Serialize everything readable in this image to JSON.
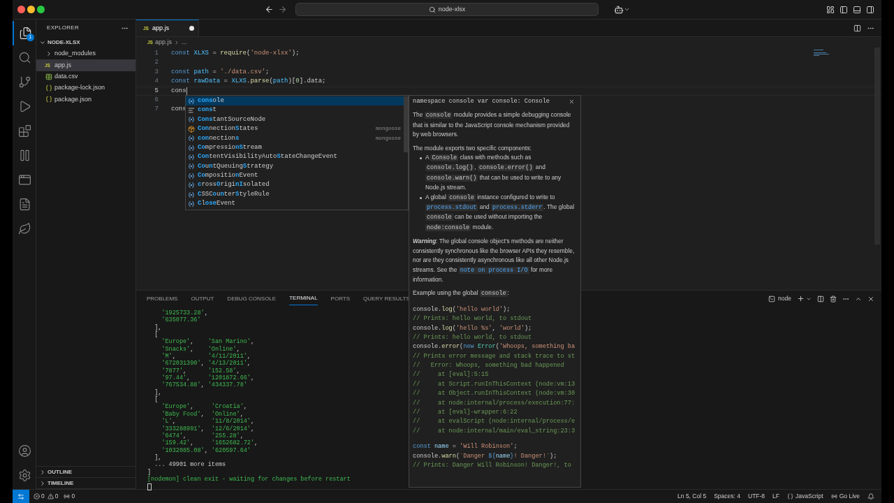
{
  "window": {
    "search": "node-xlsx"
  },
  "activity_bar": {
    "items": [
      {
        "kind": "files",
        "selected": true,
        "badge": "1"
      },
      {
        "kind": "search",
        "selected": false
      },
      {
        "kind": "source-control",
        "selected": false
      },
      {
        "kind": "run",
        "selected": false
      },
      {
        "kind": "extensions",
        "selected": false
      },
      {
        "kind": "bars",
        "selected": false
      },
      {
        "kind": "window",
        "selected": false
      },
      {
        "kind": "page",
        "selected": false
      },
      {
        "kind": "leaf",
        "selected": false
      }
    ],
    "bottom": [
      {
        "kind": "account"
      },
      {
        "kind": "settings"
      }
    ]
  },
  "sidebar": {
    "title": "EXPLORER",
    "section": {
      "label": "NODE-XLSX",
      "expanded": true,
      "children": [
        {
          "label": "node_modules",
          "kind": "folder",
          "expanded": false,
          "selected": false
        },
        {
          "label": "app.js",
          "kind": "js",
          "icon_text": "JS",
          "selected": true
        },
        {
          "label": "data.csv",
          "kind": "csv",
          "selected": false
        },
        {
          "label": "package-lock.json",
          "kind": "json",
          "selected": false
        },
        {
          "label": "package.json",
          "kind": "json",
          "selected": false
        }
      ]
    },
    "bottom_sections": [
      {
        "label": "OUTLINE",
        "expanded": false
      },
      {
        "label": "TIMELINE",
        "expanded": false
      }
    ]
  },
  "editor": {
    "tabs": [
      {
        "label": "app.js",
        "icon_text": "JS",
        "selected": true,
        "modified": true
      }
    ],
    "breadcrumb": {
      "icon_text": "JS",
      "file": "app.js",
      "rest": "..."
    },
    "lines": [
      {
        "number": "1",
        "current": false,
        "tokens": [
          {
            "text": "const ",
            "kind": "kw"
          },
          {
            "text": "XLXS",
            "kind": "const"
          },
          {
            "text": " = ",
            "kind": "p"
          },
          {
            "text": "require",
            "kind": "fn"
          },
          {
            "text": "(",
            "kind": "p"
          },
          {
            "text": "'node-xlsx'",
            "kind": "str"
          },
          {
            "text": ");",
            "kind": "p"
          }
        ]
      },
      {
        "number": "2",
        "current": false
      },
      {
        "number": "3",
        "current": false,
        "tokens": [
          {
            "text": "const ",
            "kind": "kw"
          },
          {
            "text": "path",
            "kind": "const"
          },
          {
            "text": " = ",
            "kind": "p"
          },
          {
            "text": "'./data.csv'",
            "kind": "str"
          },
          {
            "text": ";",
            "kind": "p"
          }
        ]
      },
      {
        "number": "4",
        "current": false,
        "tokens": [
          {
            "text": "const ",
            "kind": "kw"
          },
          {
            "text": "rawData",
            "kind": "const"
          },
          {
            "text": " = ",
            "kind": "p"
          },
          {
            "text": "XLXS",
            "kind": "const"
          },
          {
            "text": ".",
            "kind": "p"
          },
          {
            "text": "parse",
            "kind": "fn"
          },
          {
            "text": "(",
            "kind": "p"
          },
          {
            "text": "path",
            "kind": "const"
          },
          {
            "text": ")[",
            "kind": "p"
          },
          {
            "text": "0",
            "kind": "num"
          },
          {
            "text": "].data;",
            "kind": "p"
          }
        ]
      },
      {
        "number": "5",
        "current": true,
        "tokens": [
          {
            "text": "cons",
            "kind": "p"
          }
        ]
      },
      {
        "number": "6",
        "current": false
      },
      {
        "number": "7",
        "current": false,
        "tokens": [
          {
            "text": "cons",
            "kind": "p"
          }
        ]
      }
    ]
  },
  "suggestions": [
    {
      "kind": "variable",
      "selected": true,
      "segments": [
        {
          "text": "cons",
          "kind": "match"
        },
        {
          "text": "ole",
          "kind": "rest"
        }
      ]
    },
    {
      "kind": "snippet",
      "selected": false,
      "segments": [
        {
          "text": "cons",
          "kind": "match"
        },
        {
          "text": "t",
          "kind": "rest"
        }
      ]
    },
    {
      "kind": "variable",
      "selected": false,
      "segments": [
        {
          "text": "Cons",
          "kind": "match"
        },
        {
          "text": "tantSourceNode",
          "kind": "rest"
        }
      ]
    },
    {
      "kind": "module",
      "selected": false,
      "detail": "mongoose",
      "segments": [
        {
          "text": "Con",
          "kind": "match"
        },
        {
          "text": "nection",
          "kind": "rest"
        },
        {
          "text": "S",
          "kind": "match"
        },
        {
          "text": "tates",
          "kind": "rest"
        }
      ]
    },
    {
      "kind": "variable",
      "selected": false,
      "detail": "mongoose",
      "segments": [
        {
          "text": "con",
          "kind": "match"
        },
        {
          "text": "nection",
          "kind": "rest"
        },
        {
          "text": "s",
          "kind": "match"
        }
      ]
    },
    {
      "kind": "variable",
      "selected": false,
      "segments": [
        {
          "text": "Co",
          "kind": "match"
        },
        {
          "text": "mpressio",
          "kind": "rest"
        },
        {
          "text": "nS",
          "kind": "match"
        },
        {
          "text": "tream",
          "kind": "rest"
        }
      ]
    },
    {
      "kind": "variable",
      "selected": false,
      "segments": [
        {
          "text": "Con",
          "kind": "match"
        },
        {
          "text": "tentVisibilityAuto",
          "kind": "rest"
        },
        {
          "text": "S",
          "kind": "match"
        },
        {
          "text": "tateChangeEvent",
          "kind": "rest"
        }
      ]
    },
    {
      "kind": "variable",
      "selected": false,
      "segments": [
        {
          "text": "Co",
          "kind": "match"
        },
        {
          "text": "u",
          "kind": "rest"
        },
        {
          "text": "n",
          "kind": "match"
        },
        {
          "text": "tQueuing",
          "kind": "rest"
        },
        {
          "text": "S",
          "kind": "match"
        },
        {
          "text": "trategy",
          "kind": "rest"
        }
      ]
    },
    {
      "kind": "variable",
      "selected": false,
      "segments": [
        {
          "text": "Co",
          "kind": "match"
        },
        {
          "text": "mpositio",
          "kind": "rest"
        },
        {
          "text": "n",
          "kind": "match"
        },
        {
          "text": "Event",
          "kind": "rest"
        }
      ]
    },
    {
      "kind": "variable",
      "selected": false,
      "segments": [
        {
          "text": "c",
          "kind": "match"
        },
        {
          "text": "ross",
          "kind": "rest"
        },
        {
          "text": "O",
          "kind": "match"
        },
        {
          "text": "rigi",
          "kind": "rest"
        },
        {
          "text": "nI",
          "kind": "match"
        },
        {
          "text": "solated",
          "kind": "rest"
        }
      ]
    },
    {
      "kind": "variable",
      "selected": false,
      "segments": [
        {
          "text": "C",
          "kind": "match"
        },
        {
          "text": "SSC",
          "kind": "rest"
        },
        {
          "text": "o",
          "kind": "match"
        },
        {
          "text": "u",
          "kind": "rest"
        },
        {
          "text": "n",
          "kind": "match"
        },
        {
          "text": "ter",
          "kind": "rest"
        },
        {
          "text": "S",
          "kind": "match"
        },
        {
          "text": "tyleRule",
          "kind": "rest"
        }
      ]
    },
    {
      "kind": "variable",
      "selected": false,
      "segments": [
        {
          "text": "C",
          "kind": "match"
        },
        {
          "text": "l",
          "kind": "rest"
        },
        {
          "text": "ose",
          "kind": "match"
        },
        {
          "text": "Event",
          "kind": "rest"
        }
      ]
    }
  ],
  "docs": {
    "signature": "namespace console var console: Console",
    "blocks": [
      {
        "kind": "paragraph",
        "parts": [
          {
            "text": "The ",
            "kind": "text"
          },
          {
            "text": "console",
            "kind": "code"
          },
          {
            "text": " module provides a simple debugging console that is similar to the JavaScript console mechanism provided by web browsers.",
            "kind": "text"
          }
        ]
      },
      {
        "kind": "paragraph",
        "parts": [
          {
            "text": "The module exports two specific components:",
            "kind": "text"
          }
        ]
      },
      {
        "kind": "bullet",
        "parts": [
          {
            "text": "A ",
            "kind": "text"
          },
          {
            "text": "Console",
            "kind": "code"
          },
          {
            "text": " class with methods such as ",
            "kind": "text"
          },
          {
            "text": "console.log()",
            "kind": "code"
          },
          {
            "text": ", ",
            "kind": "text"
          },
          {
            "text": "console.error()",
            "kind": "code"
          },
          {
            "text": " and ",
            "kind": "text"
          },
          {
            "text": "console.warn()",
            "kind": "code"
          },
          {
            "text": " that can be used to write to any Node.js stream.",
            "kind": "text"
          }
        ]
      },
      {
        "kind": "bullet",
        "parts": [
          {
            "text": "A global ",
            "kind": "text"
          },
          {
            "text": "console",
            "kind": "code"
          },
          {
            "text": " instance configured to write to ",
            "kind": "text"
          },
          {
            "text": "process.stdout",
            "kind": "link"
          },
          {
            "text": " and ",
            "kind": "text"
          },
          {
            "text": "process.stderr",
            "kind": "link"
          },
          {
            "text": ". The global ",
            "kind": "text"
          },
          {
            "text": "console",
            "kind": "code"
          },
          {
            "text": " can be used without importing the ",
            "kind": "text"
          },
          {
            "text": "node:console",
            "kind": "code"
          },
          {
            "text": " module.",
            "kind": "text"
          }
        ]
      },
      {
        "kind": "paragraph",
        "parts": [
          {
            "text": "Warning",
            "kind": "em"
          },
          {
            "text": ": The global console object's methods are neither consistently synchronous like the browser APIs they resemble, nor are they consistently asynchronous like all other Node.js streams. See the ",
            "kind": "text"
          },
          {
            "text": "note on process I/O",
            "kind": "link"
          },
          {
            "text": " for more information.",
            "kind": "text"
          }
        ]
      },
      {
        "kind": "paragraph",
        "parts": [
          {
            "text": "Example using the global ",
            "kind": "text"
          },
          {
            "text": "console",
            "kind": "code"
          },
          {
            "text": ":",
            "kind": "text"
          }
        ]
      },
      {
        "kind": "code",
        "lines": [
          {
            "tokens": [
              {
                "text": "console.",
                "kind": "p"
              },
              {
                "text": "log",
                "kind": "fn"
              },
              {
                "text": "(",
                "kind": "p"
              },
              {
                "text": "'hello world'",
                "kind": "str"
              },
              {
                "text": ");",
                "kind": "p"
              }
            ]
          },
          {
            "tokens": [
              {
                "text": "// Prints: hello world, to stdout",
                "kind": "cm"
              }
            ]
          },
          {
            "tokens": [
              {
                "text": "console.",
                "kind": "p"
              },
              {
                "text": "log",
                "kind": "fn"
              },
              {
                "text": "(",
                "kind": "p"
              },
              {
                "text": "'hello %s'",
                "kind": "str"
              },
              {
                "text": ", ",
                "kind": "p"
              },
              {
                "text": "'world'",
                "kind": "str"
              },
              {
                "text": ");",
                "kind": "p"
              }
            ]
          },
          {
            "tokens": [
              {
                "text": "// Prints: hello world, to stdout",
                "kind": "cm"
              }
            ]
          },
          {
            "tokens": [
              {
                "text": "console.",
                "kind": "p"
              },
              {
                "text": "error",
                "kind": "fn"
              },
              {
                "text": "(",
                "kind": "p"
              },
              {
                "text": "new ",
                "kind": "kw"
              },
              {
                "text": "Error",
                "kind": "cls"
              },
              {
                "text": "(",
                "kind": "p"
              },
              {
                "text": "'Whoops, something ba",
                "kind": "str"
              }
            ]
          },
          {
            "tokens": [
              {
                "text": "// Prints error message and stack trace to st",
                "kind": "cm"
              }
            ]
          },
          {
            "tokens": [
              {
                "text": "//   Error: Whoops, something bad happened",
                "kind": "cm"
              }
            ]
          },
          {
            "tokens": [
              {
                "text": "//     at [eval]:5:15",
                "kind": "cm"
              }
            ]
          },
          {
            "tokens": [
              {
                "text": "//     at Script.runInThisContext (node:vm:13",
                "kind": "cm"
              }
            ]
          },
          {
            "tokens": [
              {
                "text": "//     at Object.runInThisContext (node:vm:30",
                "kind": "cm"
              }
            ]
          },
          {
            "tokens": [
              {
                "text": "//     at node:internal/process/execution:77:",
                "kind": "cm"
              }
            ]
          },
          {
            "tokens": [
              {
                "text": "//     at [eval]-wrapper:6:22",
                "kind": "cm"
              }
            ]
          },
          {
            "tokens": [
              {
                "text": "//     at evalScript (node:internal/process/e",
                "kind": "cm"
              }
            ]
          },
          {
            "tokens": [
              {
                "text": "//     at node:internal/main/eval_string:23:3",
                "kind": "cm"
              }
            ]
          }
        ]
      },
      {
        "kind": "code",
        "lines": [
          {
            "tokens": [
              {
                "text": "const ",
                "kind": "kw"
              },
              {
                "text": "name",
                "kind": "var"
              },
              {
                "text": " = ",
                "kind": "p"
              },
              {
                "text": "'Will Robinson'",
                "kind": "str"
              },
              {
                "text": ";",
                "kind": "p"
              }
            ]
          },
          {
            "tokens": [
              {
                "text": "console.",
                "kind": "p"
              },
              {
                "text": "warn",
                "kind": "fn"
              },
              {
                "text": "(",
                "kind": "p"
              },
              {
                "text": "`Danger ",
                "kind": "str"
              },
              {
                "text": "${",
                "kind": "kw"
              },
              {
                "text": "name",
                "kind": "var"
              },
              {
                "text": "}",
                "kind": "kw"
              },
              {
                "text": "! Danger!`",
                "kind": "str"
              },
              {
                "text": ");",
                "kind": "p"
              }
            ]
          },
          {
            "tokens": [
              {
                "text": "// Prints: Danger Will Robinson! Danger!, to",
                "kind": "cm"
              }
            ]
          }
        ]
      }
    ]
  },
  "panel": {
    "tabs": [
      {
        "label": "PROBLEMS",
        "selected": false
      },
      {
        "label": "OUTPUT",
        "selected": false
      },
      {
        "label": "DEBUG CONSOLE",
        "selected": false
      },
      {
        "label": "TERMINAL",
        "selected": true
      },
      {
        "label": "PORTS",
        "selected": false
      },
      {
        "label": "QUERY RESULTS",
        "selected": false
      }
    ],
    "terminal_name": "node",
    "lines": [
      {
        "kind": "data",
        "text": "    '1925733.28',"
      },
      {
        "kind": "data",
        "text": "    '635077.36'"
      },
      {
        "kind": "data",
        "text": "  ],"
      },
      {
        "kind": "data",
        "text": "  ["
      },
      {
        "kind": "data",
        "text": "    'Europe',    'San Marino',"
      },
      {
        "kind": "data",
        "text": "    'Snacks',    'Online',"
      },
      {
        "kind": "data",
        "text": "    'M',         '4/11/2011',"
      },
      {
        "kind": "data",
        "text": "    '672031390', '4/13/2011',"
      },
      {
        "kind": "data",
        "text": "    '7877',      '152.58',"
      },
      {
        "kind": "data",
        "text": "    '97.44',     '1201872.66',"
      },
      {
        "kind": "data",
        "text": "    '767534.88', '434337.78'"
      },
      {
        "kind": "data",
        "text": "  ],"
      },
      {
        "kind": "data",
        "text": "  ["
      },
      {
        "kind": "data",
        "text": "    'Europe',     'Croatia',"
      },
      {
        "kind": "data",
        "text": "    'Baby Food',  'Online',"
      },
      {
        "kind": "data",
        "text": "    'L',          '11/8/2014',"
      },
      {
        "kind": "data",
        "text": "    '333288991',  '12/6/2014',"
      },
      {
        "kind": "data",
        "text": "    '6474',       '255.28',"
      },
      {
        "kind": "data",
        "text": "    '159.42',     '1652682.72',"
      },
      {
        "kind": "data",
        "text": "    '1032085.08', '620597.64'"
      },
      {
        "kind": "data",
        "text": "  ],"
      },
      {
        "kind": "data",
        "text": "  ... 49901 more items"
      },
      {
        "kind": "data",
        "text": "]"
      },
      {
        "kind": "status",
        "text": "[nodemon] clean exit - waiting for changes before restart"
      }
    ]
  },
  "status_bar": {
    "errors": "0",
    "warnings": "0",
    "ports": "0",
    "right": [
      {
        "kind": "text",
        "label": "Ln 5, Col 5"
      },
      {
        "kind": "text",
        "label": "Spaces: 4"
      },
      {
        "kind": "text",
        "label": "UTF-8"
      },
      {
        "kind": "text",
        "label": "LF"
      },
      {
        "kind": "language",
        "label": "JavaScript"
      },
      {
        "kind": "live",
        "label": "Go Live"
      }
    ]
  }
}
